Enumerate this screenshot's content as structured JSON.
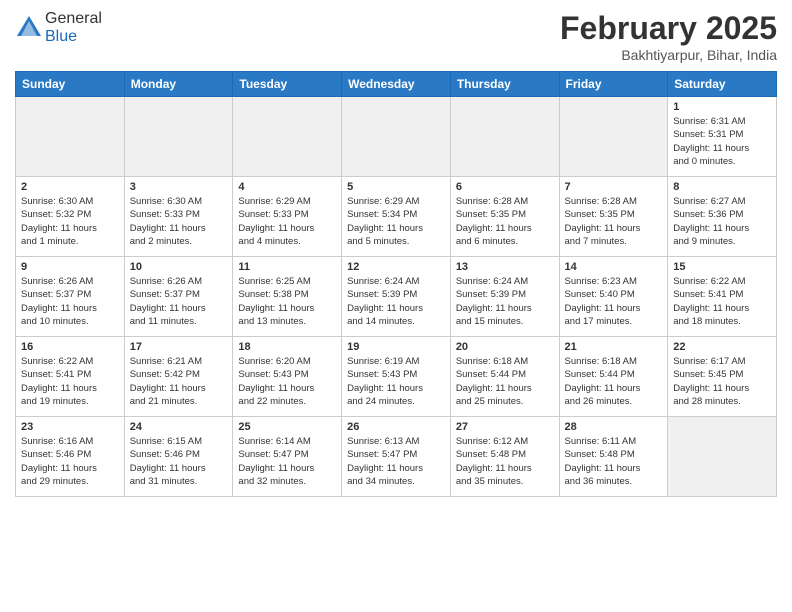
{
  "logo": {
    "general": "General",
    "blue": "Blue"
  },
  "title": "February 2025",
  "location": "Bakhtiyarpur, Bihar, India",
  "days_header": [
    "Sunday",
    "Monday",
    "Tuesday",
    "Wednesday",
    "Thursday",
    "Friday",
    "Saturday"
  ],
  "weeks": [
    [
      {
        "num": "",
        "info": "",
        "gray": true
      },
      {
        "num": "",
        "info": "",
        "gray": true
      },
      {
        "num": "",
        "info": "",
        "gray": true
      },
      {
        "num": "",
        "info": "",
        "gray": true
      },
      {
        "num": "",
        "info": "",
        "gray": true
      },
      {
        "num": "",
        "info": "",
        "gray": true
      },
      {
        "num": "1",
        "info": "Sunrise: 6:31 AM\nSunset: 5:31 PM\nDaylight: 11 hours\nand 0 minutes.",
        "gray": false
      }
    ],
    [
      {
        "num": "2",
        "info": "Sunrise: 6:30 AM\nSunset: 5:32 PM\nDaylight: 11 hours\nand 1 minute.",
        "gray": false
      },
      {
        "num": "3",
        "info": "Sunrise: 6:30 AM\nSunset: 5:33 PM\nDaylight: 11 hours\nand 2 minutes.",
        "gray": false
      },
      {
        "num": "4",
        "info": "Sunrise: 6:29 AM\nSunset: 5:33 PM\nDaylight: 11 hours\nand 4 minutes.",
        "gray": false
      },
      {
        "num": "5",
        "info": "Sunrise: 6:29 AM\nSunset: 5:34 PM\nDaylight: 11 hours\nand 5 minutes.",
        "gray": false
      },
      {
        "num": "6",
        "info": "Sunrise: 6:28 AM\nSunset: 5:35 PM\nDaylight: 11 hours\nand 6 minutes.",
        "gray": false
      },
      {
        "num": "7",
        "info": "Sunrise: 6:28 AM\nSunset: 5:35 PM\nDaylight: 11 hours\nand 7 minutes.",
        "gray": false
      },
      {
        "num": "8",
        "info": "Sunrise: 6:27 AM\nSunset: 5:36 PM\nDaylight: 11 hours\nand 9 minutes.",
        "gray": false
      }
    ],
    [
      {
        "num": "9",
        "info": "Sunrise: 6:26 AM\nSunset: 5:37 PM\nDaylight: 11 hours\nand 10 minutes.",
        "gray": false
      },
      {
        "num": "10",
        "info": "Sunrise: 6:26 AM\nSunset: 5:37 PM\nDaylight: 11 hours\nand 11 minutes.",
        "gray": false
      },
      {
        "num": "11",
        "info": "Sunrise: 6:25 AM\nSunset: 5:38 PM\nDaylight: 11 hours\nand 13 minutes.",
        "gray": false
      },
      {
        "num": "12",
        "info": "Sunrise: 6:24 AM\nSunset: 5:39 PM\nDaylight: 11 hours\nand 14 minutes.",
        "gray": false
      },
      {
        "num": "13",
        "info": "Sunrise: 6:24 AM\nSunset: 5:39 PM\nDaylight: 11 hours\nand 15 minutes.",
        "gray": false
      },
      {
        "num": "14",
        "info": "Sunrise: 6:23 AM\nSunset: 5:40 PM\nDaylight: 11 hours\nand 17 minutes.",
        "gray": false
      },
      {
        "num": "15",
        "info": "Sunrise: 6:22 AM\nSunset: 5:41 PM\nDaylight: 11 hours\nand 18 minutes.",
        "gray": false
      }
    ],
    [
      {
        "num": "16",
        "info": "Sunrise: 6:22 AM\nSunset: 5:41 PM\nDaylight: 11 hours\nand 19 minutes.",
        "gray": false
      },
      {
        "num": "17",
        "info": "Sunrise: 6:21 AM\nSunset: 5:42 PM\nDaylight: 11 hours\nand 21 minutes.",
        "gray": false
      },
      {
        "num": "18",
        "info": "Sunrise: 6:20 AM\nSunset: 5:43 PM\nDaylight: 11 hours\nand 22 minutes.",
        "gray": false
      },
      {
        "num": "19",
        "info": "Sunrise: 6:19 AM\nSunset: 5:43 PM\nDaylight: 11 hours\nand 24 minutes.",
        "gray": false
      },
      {
        "num": "20",
        "info": "Sunrise: 6:18 AM\nSunset: 5:44 PM\nDaylight: 11 hours\nand 25 minutes.",
        "gray": false
      },
      {
        "num": "21",
        "info": "Sunrise: 6:18 AM\nSunset: 5:44 PM\nDaylight: 11 hours\nand 26 minutes.",
        "gray": false
      },
      {
        "num": "22",
        "info": "Sunrise: 6:17 AM\nSunset: 5:45 PM\nDaylight: 11 hours\nand 28 minutes.",
        "gray": false
      }
    ],
    [
      {
        "num": "23",
        "info": "Sunrise: 6:16 AM\nSunset: 5:46 PM\nDaylight: 11 hours\nand 29 minutes.",
        "gray": false
      },
      {
        "num": "24",
        "info": "Sunrise: 6:15 AM\nSunset: 5:46 PM\nDaylight: 11 hours\nand 31 minutes.",
        "gray": false
      },
      {
        "num": "25",
        "info": "Sunrise: 6:14 AM\nSunset: 5:47 PM\nDaylight: 11 hours\nand 32 minutes.",
        "gray": false
      },
      {
        "num": "26",
        "info": "Sunrise: 6:13 AM\nSunset: 5:47 PM\nDaylight: 11 hours\nand 34 minutes.",
        "gray": false
      },
      {
        "num": "27",
        "info": "Sunrise: 6:12 AM\nSunset: 5:48 PM\nDaylight: 11 hours\nand 35 minutes.",
        "gray": false
      },
      {
        "num": "28",
        "info": "Sunrise: 6:11 AM\nSunset: 5:48 PM\nDaylight: 11 hours\nand 36 minutes.",
        "gray": false
      },
      {
        "num": "",
        "info": "",
        "gray": true
      }
    ]
  ]
}
